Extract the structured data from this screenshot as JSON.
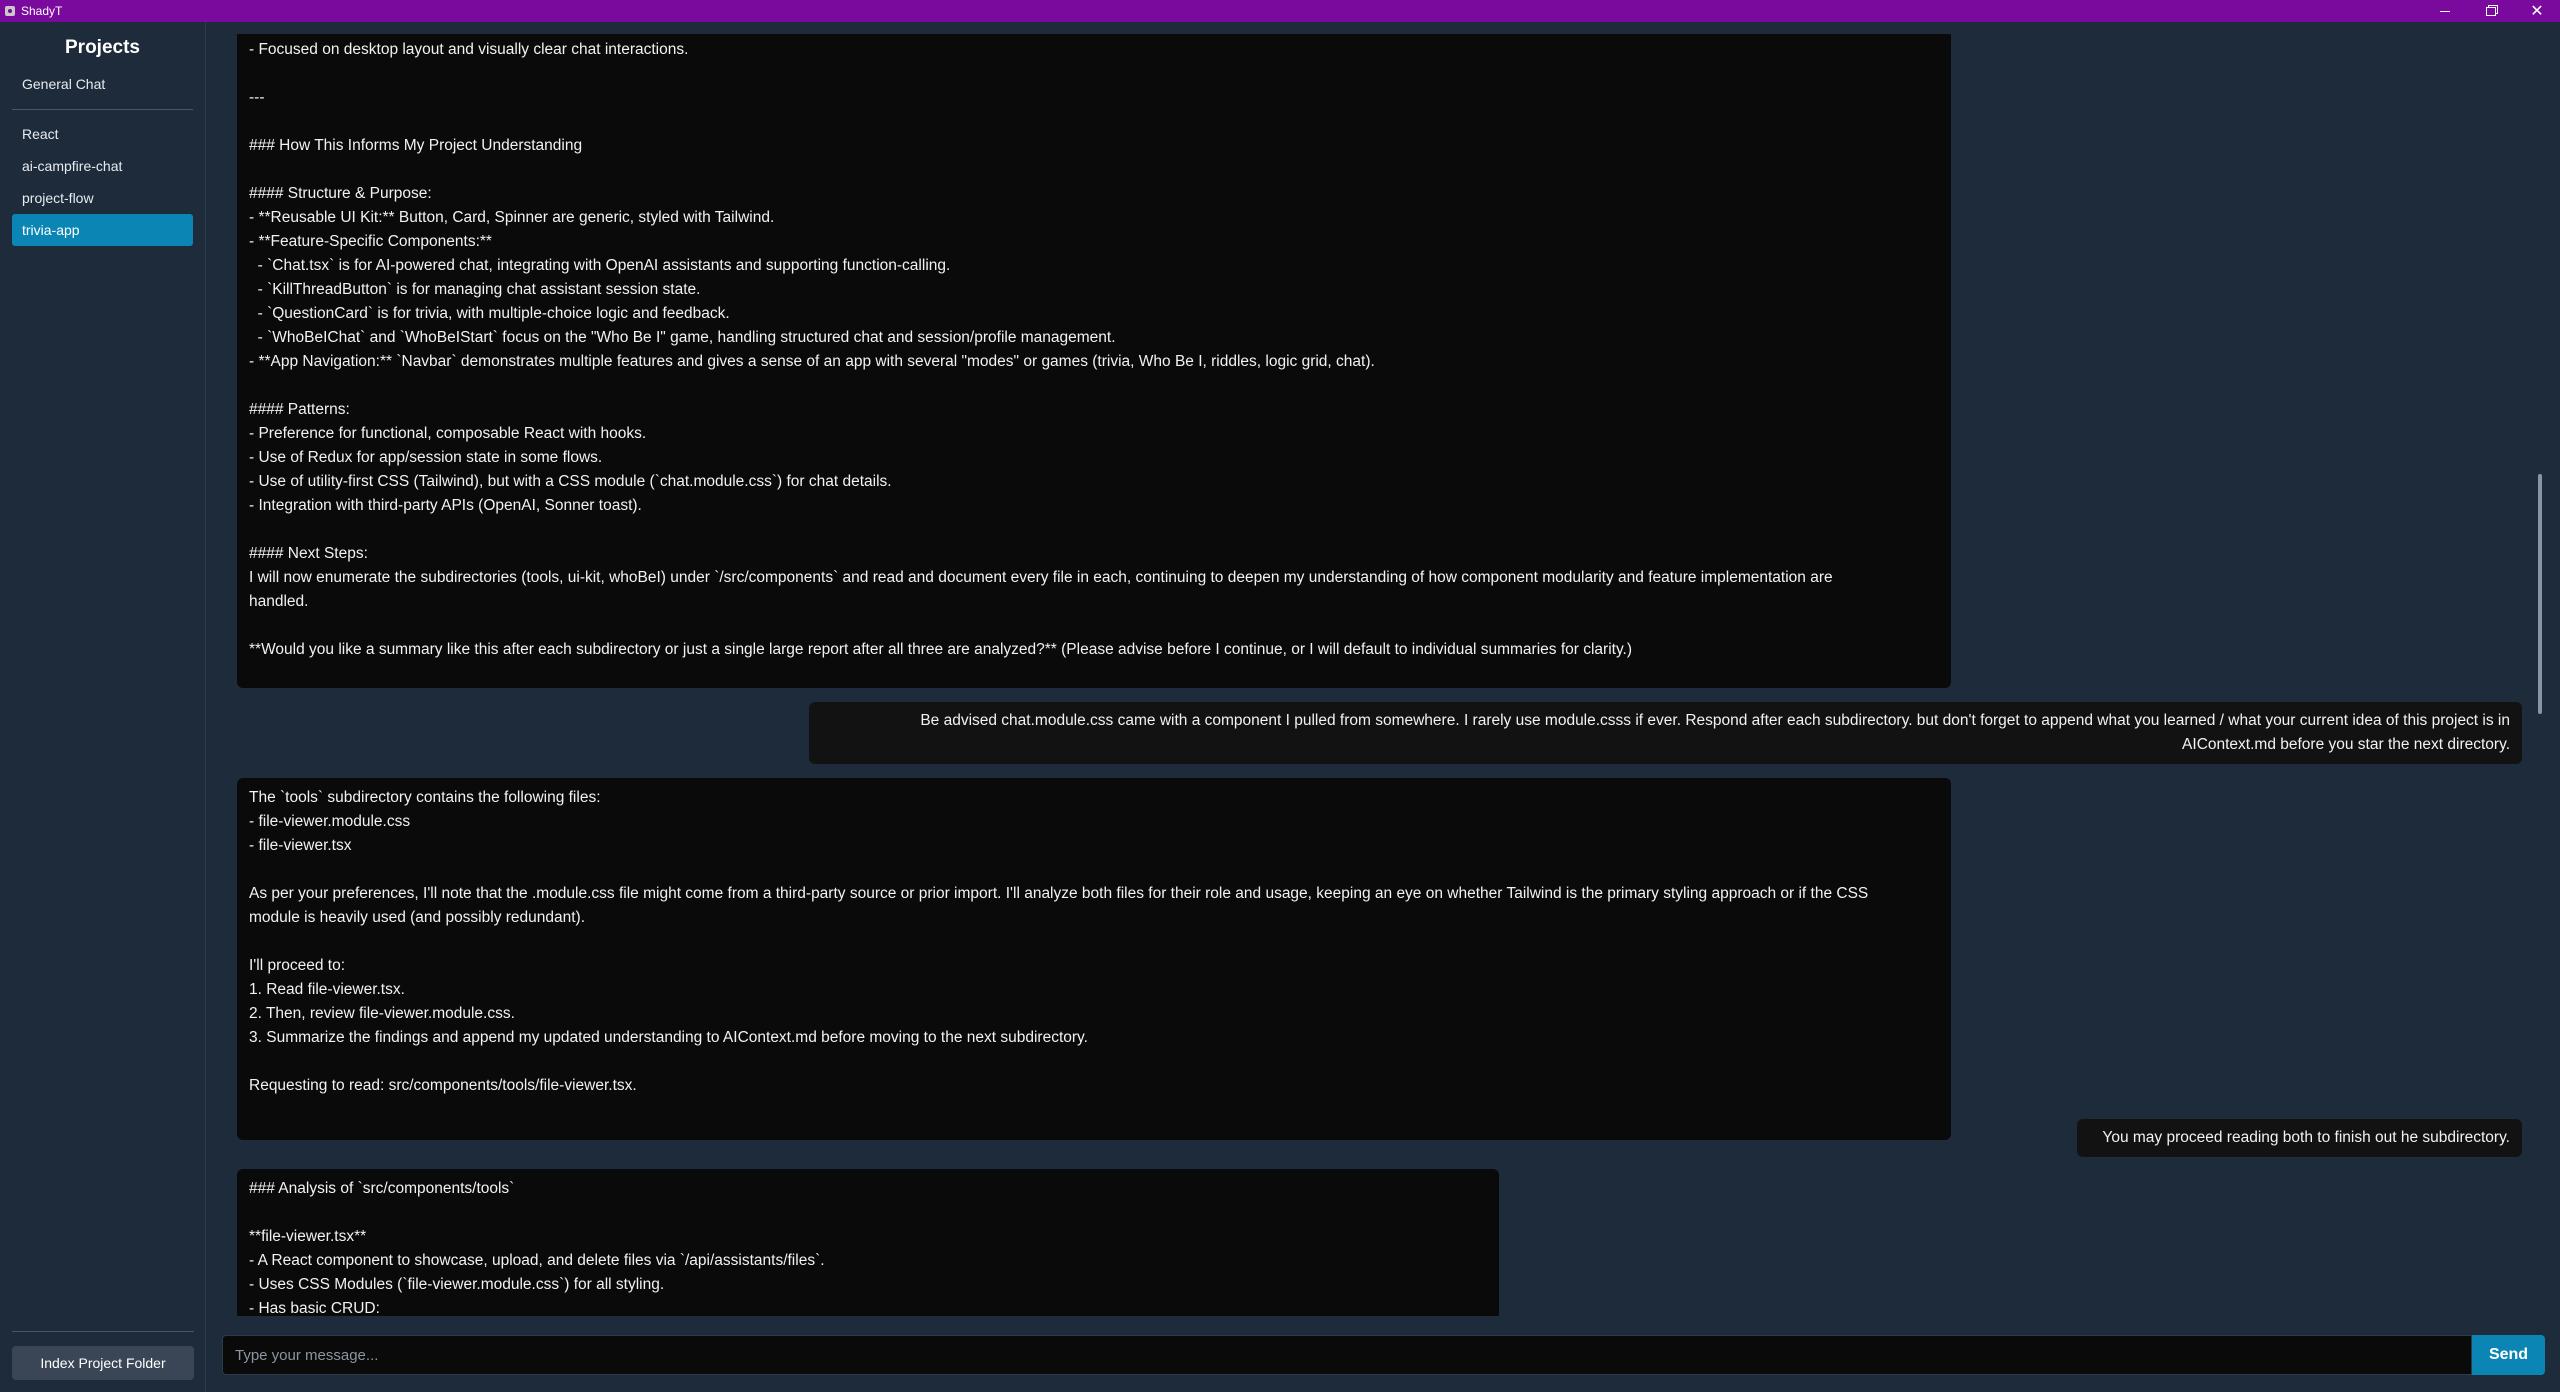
{
  "window": {
    "title": "ShadyT",
    "minimize_label": "–",
    "maximize_label": "",
    "close_label": "✕"
  },
  "sidebar": {
    "heading": "Projects",
    "general": "General Chat",
    "projects": [
      "React",
      "ai-campfire-chat",
      "project-flow",
      "trivia-app"
    ],
    "active_project": "trivia-app",
    "index_button": "Index Project Folder"
  },
  "messages": [
    {
      "role": "assistant",
      "text": "- Styles chat's flex layout, message bubbles for user/assistant/code, forms, and inputs.\n- Focused on desktop layout and visually clear chat interactions.\n\n---\n\n### How This Informs My Project Understanding\n\n#### Structure & Purpose:\n- **Reusable UI Kit:** Button, Card, Spinner are generic, styled with Tailwind.\n- **Feature-Specific Components:**\n  - `Chat.tsx` is for AI-powered chat, integrating with OpenAI assistants and supporting function-calling.\n  - `KillThreadButton` is for managing chat assistant session state.\n  - `QuestionCard` is for trivia, with multiple-choice logic and feedback.\n  - `WhoBeIChat` and `WhoBeIStart` focus on the \"Who Be I\" game, handling structured chat and session/profile management.\n- **App Navigation:** `Navbar` demonstrates multiple features and gives a sense of an app with several \"modes\" or games (trivia, Who Be I, riddles, logic grid, chat).\n\n#### Patterns:\n- Preference for functional, composable React with hooks.\n- Use of Redux for app/session state in some flows.\n- Use of utility-first CSS (Tailwind), but with a CSS module (`chat.module.css`) for chat details.\n- Integration with third-party APIs (OpenAI, Sonner toast).\n\n#### Next Steps:\nI will now enumerate the subdirectories (tools, ui-kit, whoBeI) under `/src/components` and read and document every file in each, continuing to deepen my understanding of how component modularity and feature implementation are\nhandled.\n\n**Would you like a summary like this after each subdirectory or just a single large report after all three are analyzed?** (Please advise before I continue, or I will default to individual summaries for clarity.)"
    },
    {
      "role": "user",
      "text": "Be advised chat.module.css came with a component I pulled from somewhere. I rarely use module.csss if ever. Respond after each subdirectory. but don't forget to append what you learned / what your current idea of this project is in\nAIContext.md before you star the next directory."
    },
    {
      "role": "assistant",
      "text": "The `tools` subdirectory contains the following files:\n- file-viewer.module.css\n- file-viewer.tsx\n\nAs per your preferences, I'll note that the .module.css file might come from a third-party source or prior import. I'll analyze both files for their role and usage, keeping an eye on whether Tailwind is the primary styling approach or if the CSS\nmodule is heavily used (and possibly redundant).\n\nI'll proceed to:\n1. Read file-viewer.tsx.\n2. Then, review file-viewer.module.css.\n3. Summarize the findings and append my updated understanding to AIContext.md before moving to the next subdirectory.\n\nRequesting to read: src/components/tools/file-viewer.tsx."
    },
    {
      "role": "user",
      "text": "You may proceed reading both to finish out he subdirectory."
    },
    {
      "role": "assistant",
      "text": "### Analysis of `src/components/tools`\n\n**file-viewer.tsx**\n- A React component to showcase, upload, and delete files via `/api/assistants/files`.\n- Uses CSS Modules (`file-viewer.module.css`) for all styling.\n- Has basic CRUD:"
    }
  ],
  "composer": {
    "placeholder": "Type your message...",
    "send_label": "Send"
  },
  "colors": {
    "titlebar": "#7a0a9e",
    "background": "#1e2b3a",
    "accent": "#0b86b4",
    "bubble": "#0a0a0a"
  }
}
